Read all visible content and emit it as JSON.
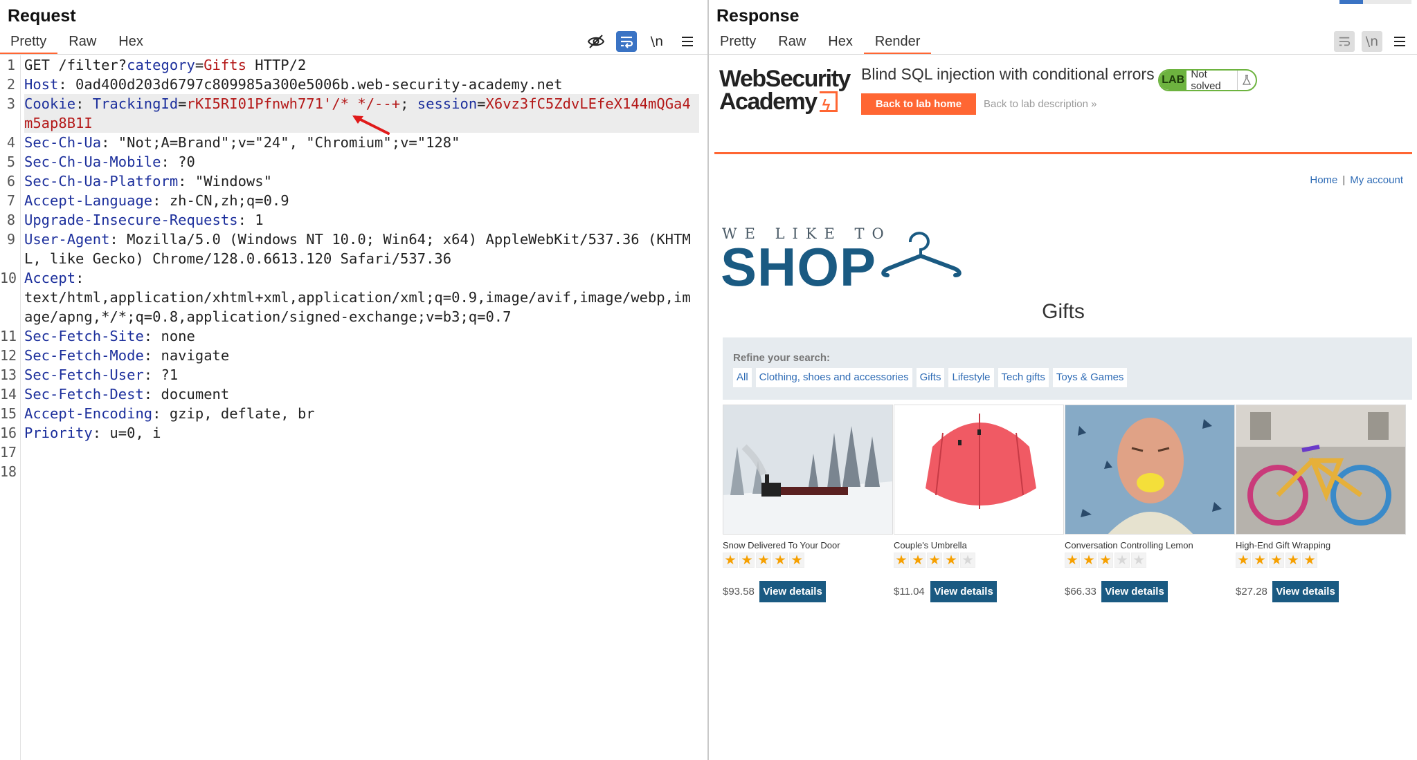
{
  "request": {
    "title": "Request",
    "tabs": [
      "Pretty",
      "Raw",
      "Hex"
    ],
    "active_tab": "Pretty",
    "toolbar_icons": [
      "eye-slash-icon",
      "wrap-icon",
      "newline-icon",
      "menu-icon"
    ],
    "newline_label": "\\n",
    "lines": [
      {
        "num": "1",
        "parts": [
          {
            "t": "GET /filter?",
            "c": "p"
          },
          {
            "t": "category",
            "c": "k"
          },
          {
            "t": "=",
            "c": "p"
          },
          {
            "t": "Gifts",
            "c": "v"
          },
          {
            "t": " HTTP/2",
            "c": "p"
          }
        ]
      },
      {
        "num": "2",
        "parts": [
          {
            "t": "Host",
            "c": "k"
          },
          {
            "t": ": 0ad400d203d6797c809985a300e5006b.web-security-academy.net",
            "c": "p"
          }
        ]
      },
      {
        "num": "3",
        "highlight": true,
        "parts": [
          {
            "t": "Cookie",
            "c": "k"
          },
          {
            "t": ": ",
            "c": "p"
          },
          {
            "t": "TrackingId",
            "c": "k"
          },
          {
            "t": "=",
            "c": "p"
          },
          {
            "t": "rKI5RI01Pfnwh771'/* */--+",
            "c": "v"
          },
          {
            "t": "; ",
            "c": "p"
          },
          {
            "t": "session",
            "c": "k"
          },
          {
            "t": "=",
            "c": "p"
          },
          {
            "t": "X6vz3fC5ZdvLEfeX144mQGa4m5ap8B1I",
            "c": "v"
          }
        ]
      },
      {
        "num": "4",
        "parts": [
          {
            "t": "Sec-Ch-Ua",
            "c": "k"
          },
          {
            "t": ": \"Not;A=Brand\";v=\"24\", \"Chromium\";v=\"128\"",
            "c": "p"
          }
        ]
      },
      {
        "num": "5",
        "parts": [
          {
            "t": "Sec-Ch-Ua-Mobile",
            "c": "k"
          },
          {
            "t": ": ?0",
            "c": "p"
          }
        ]
      },
      {
        "num": "6",
        "parts": [
          {
            "t": "Sec-Ch-Ua-Platform",
            "c": "k"
          },
          {
            "t": ": \"Windows\"",
            "c": "p"
          }
        ]
      },
      {
        "num": "7",
        "parts": [
          {
            "t": "Accept-Language",
            "c": "k"
          },
          {
            "t": ": zh-CN,zh;q=0.9",
            "c": "p"
          }
        ]
      },
      {
        "num": "8",
        "parts": [
          {
            "t": "Upgrade-Insecure-Requests",
            "c": "k"
          },
          {
            "t": ": 1",
            "c": "p"
          }
        ]
      },
      {
        "num": "9",
        "parts": [
          {
            "t": "User-Agent",
            "c": "k"
          },
          {
            "t": ": Mozilla/5.0 (Windows NT 10.0; Win64; x64) AppleWebKit/537.36 (KHTML, like Gecko) Chrome/128.0.6613.120 Safari/537.36",
            "c": "p"
          }
        ]
      },
      {
        "num": "10",
        "parts": [
          {
            "t": "Accept",
            "c": "k"
          },
          {
            "t": ":\ntext/html,application/xhtml+xml,application/xml;q=0.9,image/avif,image/webp,image/apng,*/*;q=0.8,application/signed-exchange;v=b3;q=0.7",
            "c": "p"
          }
        ]
      },
      {
        "num": "11",
        "parts": [
          {
            "t": "Sec-Fetch-Site",
            "c": "k"
          },
          {
            "t": ": none",
            "c": "p"
          }
        ]
      },
      {
        "num": "12",
        "parts": [
          {
            "t": "Sec-Fetch-Mode",
            "c": "k"
          },
          {
            "t": ": navigate",
            "c": "p"
          }
        ]
      },
      {
        "num": "13",
        "parts": [
          {
            "t": "Sec-Fetch-User",
            "c": "k"
          },
          {
            "t": ": ?1",
            "c": "p"
          }
        ]
      },
      {
        "num": "14",
        "parts": [
          {
            "t": "Sec-Fetch-Dest",
            "c": "k"
          },
          {
            "t": ": document",
            "c": "p"
          }
        ]
      },
      {
        "num": "15",
        "parts": [
          {
            "t": "Accept-Encoding",
            "c": "k"
          },
          {
            "t": ": gzip, deflate, br",
            "c": "p"
          }
        ]
      },
      {
        "num": "16",
        "parts": [
          {
            "t": "Priority",
            "c": "k"
          },
          {
            "t": ": u=0, i",
            "c": "p"
          }
        ]
      },
      {
        "num": "17",
        "parts": []
      },
      {
        "num": "18",
        "parts": []
      }
    ]
  },
  "response": {
    "title": "Response",
    "tabs": [
      "Pretty",
      "Raw",
      "Hex",
      "Render"
    ],
    "active_tab": "Render",
    "newline_label": "\\n",
    "render": {
      "brand_line1": "WebSecurity",
      "brand_line2": "Academy",
      "lab_title": "Blind SQL injection with conditional errors",
      "back_to_lab_home": "Back to lab home",
      "back_to_lab_description": "Back to lab description",
      "lab_badge": "LAB",
      "lab_status": "Not solved",
      "nav": {
        "home": "Home",
        "sep": "|",
        "my_account": "My account"
      },
      "shop_tagline": "WE LIKE TO",
      "shop_word": "SHOP",
      "category_title": "Gifts",
      "refine_label": "Refine your search:",
      "filters": [
        "All",
        "Clothing, shoes and accessories",
        "Gifts",
        "Lifestyle",
        "Tech gifts",
        "Toys & Games"
      ],
      "products": [
        {
          "name": "Snow Delivered To Your Door",
          "rating": 5,
          "price": "$93.58",
          "button": "View details"
        },
        {
          "name": "Couple's Umbrella",
          "rating": 4,
          "price": "$11.04",
          "button": "View details"
        },
        {
          "name": "Conversation Controlling Lemon",
          "rating": 3,
          "price": "$66.33",
          "button": "View details"
        },
        {
          "name": "High-End Gift Wrapping",
          "rating": 5,
          "price": "$27.28",
          "button": "View details"
        }
      ],
      "colors": {
        "orange": "#ff6633",
        "navy": "#1a5a82",
        "link": "#2e6bb5",
        "lab_green": "#6db33f",
        "star": "#f6a000"
      }
    }
  }
}
